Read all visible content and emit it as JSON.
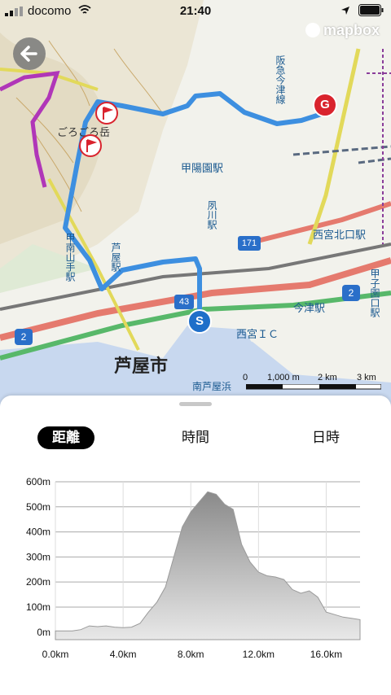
{
  "status_bar": {
    "carrier": "docomo",
    "time": "21:40"
  },
  "map": {
    "attribution": "mapbox",
    "labels": {
      "ashiya_city": "芦屋市",
      "koyoen_station": "甲陽園駅",
      "nishinomiya_ic": "西宮ＩＣ",
      "nishinomiya_kitaguchi": "西宮北口駅",
      "hanshin_imazu": "今津駅",
      "hankyu_imazu_line": "阪急今津線",
      "ashiya_station": "芦屋駅",
      "konan_yamate": "甲南山手駅",
      "gorogoro": "ごろごろ岳",
      "koshienguchi": "甲子園口駅",
      "shukugawa": "夙川駅",
      "minami_ashiya": "南芦屋浜",
      "route_171": "171",
      "route_43": "43",
      "route_2a": "2",
      "route_2b": "2"
    },
    "markers": {
      "start": "S",
      "goal": "G"
    },
    "scale": {
      "zero": "0",
      "m1": "1,000 m",
      "m2": "2 km",
      "m3": "3 km"
    }
  },
  "tabs": [
    {
      "label": "距離",
      "active": true
    },
    {
      "label": "時間",
      "active": false
    },
    {
      "label": "日時",
      "active": false
    }
  ],
  "chart_data": {
    "type": "area",
    "x": [
      0,
      0.5,
      1,
      1.5,
      2,
      2.5,
      3,
      3.5,
      4,
      4.5,
      5,
      5.5,
      6,
      6.5,
      7,
      7.5,
      8,
      8.5,
      9,
      9.5,
      10,
      10.5,
      11,
      11.5,
      12,
      12.5,
      13,
      13.5,
      14,
      14.5,
      15,
      15.5,
      16,
      16.5,
      17,
      17.5,
      18
    ],
    "y": [
      5,
      5,
      5,
      10,
      25,
      22,
      25,
      20,
      18,
      20,
      35,
      80,
      120,
      180,
      300,
      420,
      480,
      520,
      560,
      550,
      510,
      490,
      350,
      280,
      240,
      225,
      220,
      210,
      170,
      155,
      165,
      140,
      80,
      70,
      60,
      55,
      50
    ],
    "xlabel": "",
    "ylabel": "",
    "x_ticks": [
      "0.0km",
      "4.0km",
      "8.0km",
      "12.0km",
      "16.0km"
    ],
    "x_tick_values": [
      0,
      4,
      8,
      12,
      16
    ],
    "y_ticks": [
      "0m",
      "100m",
      "200m",
      "300m",
      "400m",
      "500m",
      "600m"
    ],
    "y_tick_values": [
      0,
      100,
      200,
      300,
      400,
      500,
      600
    ],
    "xlim": [
      0,
      18
    ],
    "ylim": [
      -30,
      600
    ],
    "grid": true,
    "colors": {
      "fill_top": "#8a8a8a",
      "fill_bottom": "#e8e8e8"
    }
  }
}
